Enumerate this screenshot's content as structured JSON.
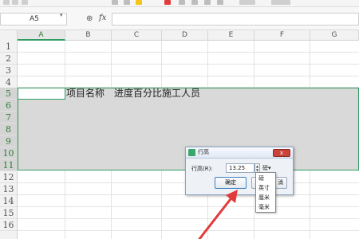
{
  "formula_bar": {
    "name_box_value": "A5",
    "fx_label": "fx",
    "formula_value": ""
  },
  "columns": [
    "A",
    "B",
    "C",
    "D",
    "E",
    "F",
    "G"
  ],
  "active_column": "A",
  "rows": [
    "1",
    "2",
    "3",
    "4",
    "5",
    "6",
    "7",
    "8",
    "9",
    "10",
    "11",
    "12",
    "13",
    "14",
    "15",
    "16"
  ],
  "selected_rows": [
    "5",
    "6",
    "7",
    "8",
    "9",
    "10",
    "11"
  ],
  "cells": {
    "B5": "项目名称",
    "C5": "进度百分比",
    "D5": "施工人员"
  },
  "dialog": {
    "title": "行高",
    "close_label": "x",
    "row_height_label": "行高(R):",
    "row_height_value": "13.25",
    "unit_selected": "磅",
    "ok_label": "确定",
    "cancel_label": "消"
  },
  "unit_options": [
    "磅",
    "英寸",
    "厘米",
    "毫米"
  ],
  "colors": {
    "selection_border": "#2e9b5f",
    "selection_fill": "#d9d9d9",
    "arrow": "#e23b3b",
    "dialog_close": "#c9433a"
  },
  "icons": {
    "zoom": "zoom-icon",
    "fx": "fx-icon",
    "dialog_app": "spreadsheet-app-icon",
    "close": "close-icon",
    "spin": "spin-arrows-icon",
    "pointer": "red-arrow-annotation"
  }
}
